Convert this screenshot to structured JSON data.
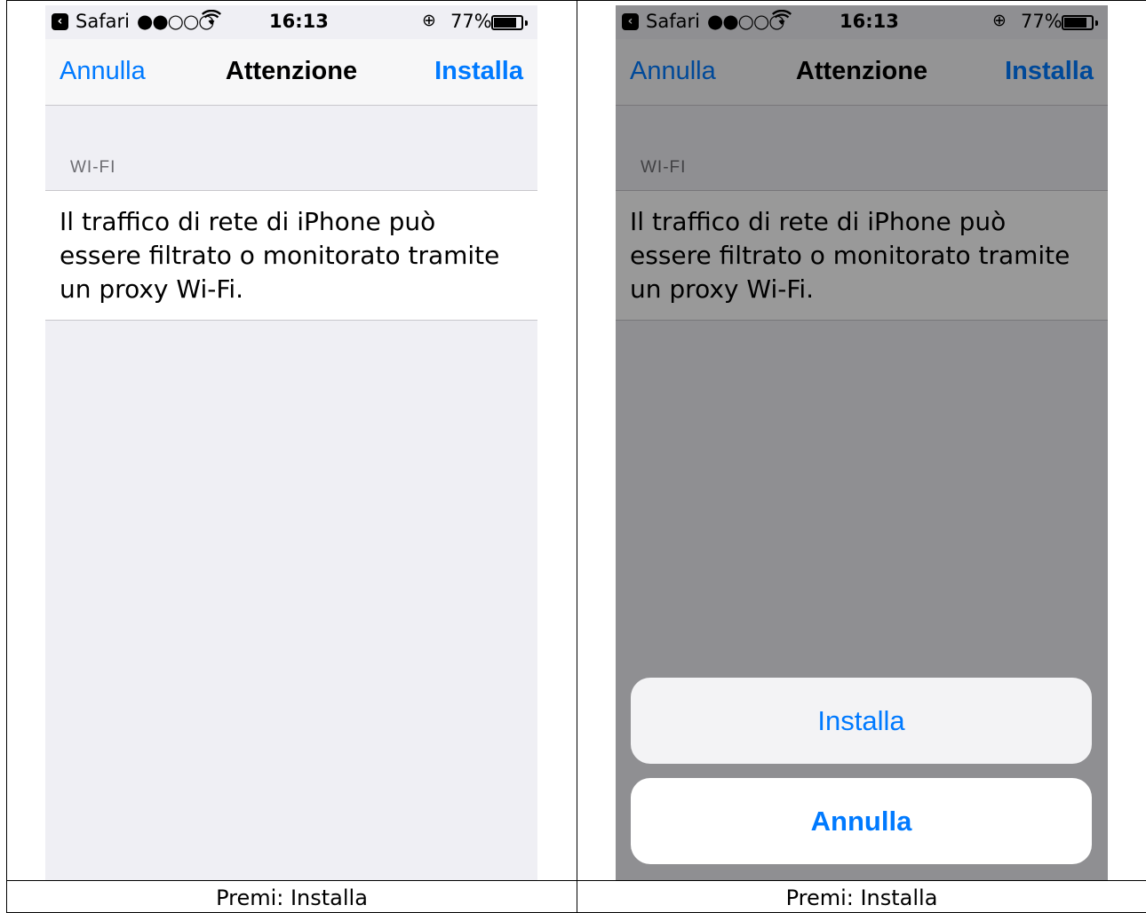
{
  "colors": {
    "ios_blue": "#007aff",
    "background": "#efeff4",
    "overlay": "rgba(0,0,0,0.40)"
  },
  "status_bar": {
    "back_app": "Safari",
    "signal": "●●○○○",
    "time": "16:13",
    "battery_percent": "77%",
    "battery_level": 0.77,
    "icons": [
      "back-arrow-icon",
      "wifi-icon",
      "rotation-lock-icon",
      "battery-icon"
    ]
  },
  "navbar": {
    "cancel_label": "Annulla",
    "title": "Attenzione",
    "install_label": "Installa"
  },
  "section": {
    "header": "WI-FI",
    "warning": "Il traffico di rete di iPhone può essere filtrato o monitorato tramite un proxy Wi-Fi."
  },
  "action_sheet": {
    "install_label": "Installa",
    "cancel_label": "Annulla"
  },
  "captions": {
    "left": "Premi: Installa",
    "right": "Premi: Installa"
  }
}
